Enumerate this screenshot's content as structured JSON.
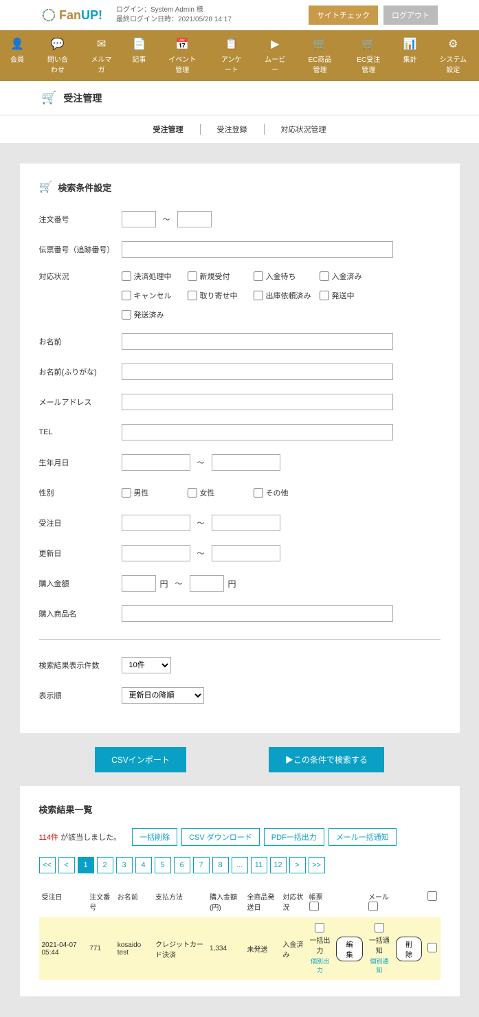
{
  "header": {
    "logo_fan": "Fan",
    "logo_up": "UP!",
    "login_line1": "ログイン：System Admin 様",
    "login_line2": "最終ログイン日時：2021/05/28 14:17",
    "btn_sitecheck": "サイトチェック",
    "btn_logout": "ログアウト"
  },
  "nav": {
    "items": [
      {
        "label": "会員",
        "icon": "👤"
      },
      {
        "label": "問い合わせ",
        "icon": "💬"
      },
      {
        "label": "メルマガ",
        "icon": "✉"
      },
      {
        "label": "記事",
        "icon": "📄"
      },
      {
        "label": "イベント管理",
        "icon": "📅"
      },
      {
        "label": "アンケート",
        "icon": "📋"
      },
      {
        "label": "ムービー",
        "icon": "▶"
      },
      {
        "label": "EC商品管理",
        "icon": "🛒"
      },
      {
        "label": "EC受注管理",
        "icon": "🛒"
      },
      {
        "label": "集計",
        "icon": "📊"
      },
      {
        "label": "システム設定",
        "icon": "⚙"
      }
    ]
  },
  "page": {
    "title": "受注管理",
    "subtabs": [
      "受注管理",
      "受注登録",
      "対応状況管理"
    ],
    "active_tab": 0
  },
  "search": {
    "heading": "検索条件設定",
    "labels": {
      "order_no": "注文番号",
      "slip_no": "伝票番号（追跡番号）",
      "status": "対応状況",
      "name": "お名前",
      "kana": "お名前(ふりがな)",
      "email": "メールアドレス",
      "tel": "TEL",
      "birth": "生年月日",
      "gender": "性別",
      "order_date": "受注日",
      "update_date": "更新日",
      "amount": "購入金額",
      "product": "購入商品名",
      "per_page": "検索結果表示件数",
      "sort": "表示順"
    },
    "status_opts": [
      "決済処理中",
      "新規受付",
      "入金待ち",
      "入金済み",
      "キャンセル",
      "取り寄せ中",
      "出庫依頼済み",
      "発送中",
      "発送済み"
    ],
    "gender_opts": [
      "男性",
      "女性",
      "その他"
    ],
    "yen": "円",
    "per_page_value": "10件",
    "sort_value": "更新日の降順"
  },
  "actions": {
    "csv_import": "CSVインポート",
    "search": "▶この条件で検索する"
  },
  "results": {
    "heading": "検索結果一覧",
    "count_num": "114件",
    "count_suffix": " が該当しました。",
    "btns": [
      "一括削除",
      "CSV ダウンロード",
      "PDF一括出力",
      "メール一括通知"
    ],
    "pages": [
      "<<",
      "<",
      "1",
      "2",
      "3",
      "4",
      "5",
      "6",
      "7",
      "8",
      "...",
      "11",
      "12",
      ">",
      ">>"
    ],
    "active_page": "1",
    "cols": {
      "date": "受注日",
      "order_no": "注文番号",
      "name": "お名前",
      "payment": "支払方法",
      "amount": "購入金額(円)",
      "ship": "全商品発送日",
      "status": "対応状況",
      "receipt": "帳票",
      "mail": "メール",
      "receipt_bulk": "一括出力",
      "receipt_indiv": "個別出力",
      "mail_bulk": "一括通知",
      "mail_indiv": "個別通知"
    },
    "row": {
      "date": "2021-04-07 05:44",
      "order_no": "771",
      "name": "kosaido test",
      "payment": "クレジットカード決済",
      "amount": "1,334",
      "ship": "未発送",
      "status": "入金済み",
      "edit": "編集",
      "delete": "削除"
    }
  }
}
